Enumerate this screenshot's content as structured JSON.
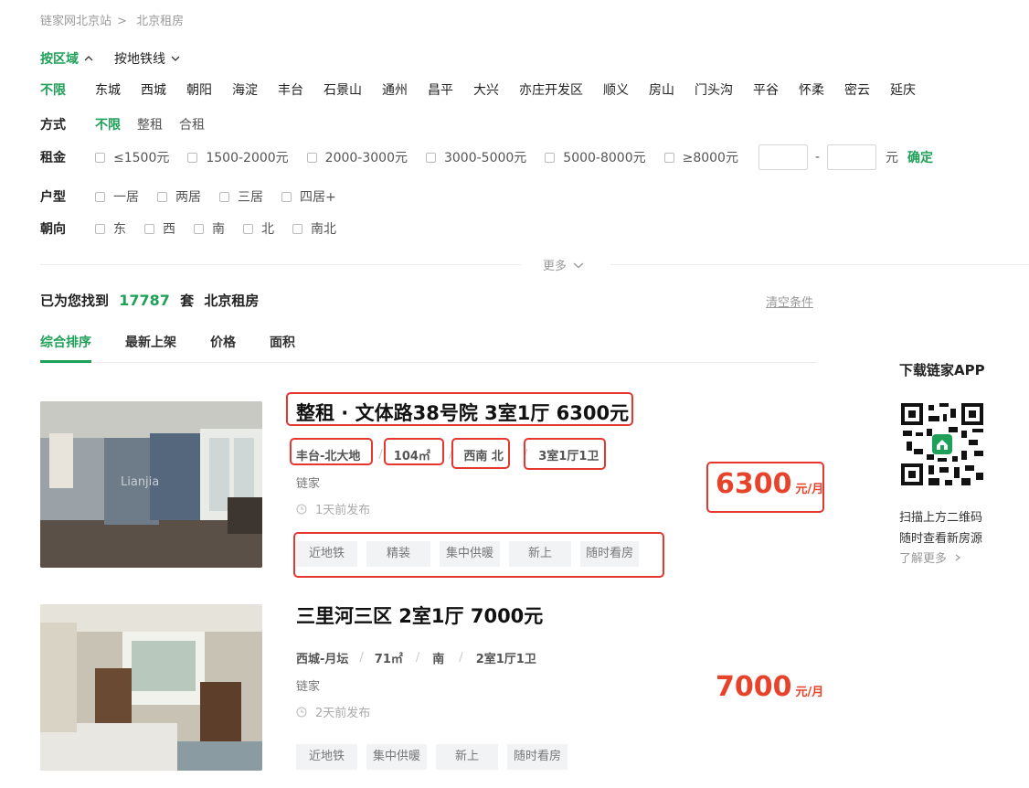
{
  "breadcrumb": {
    "site": "链家网北京站",
    "sep": ">",
    "current": "北京租房"
  },
  "filter_mode": {
    "by_area": "按区域",
    "by_subway": "按地铁线"
  },
  "areas": [
    "不限",
    "东城",
    "西城",
    "朝阳",
    "海淀",
    "丰台",
    "石景山",
    "通州",
    "昌平",
    "大兴",
    "亦庄开发区",
    "顺义",
    "房山",
    "门头沟",
    "平谷",
    "怀柔",
    "密云",
    "延庆"
  ],
  "rent_way": {
    "label": "方式",
    "options": [
      "不限",
      "整租",
      "合租"
    ]
  },
  "rent_price": {
    "label": "租金",
    "options": [
      "≤1500元",
      "1500-2000元",
      "2000-3000元",
      "3000-5000元",
      "5000-8000元",
      "≥8000元"
    ],
    "range_sep": "-",
    "unit": "元",
    "confirm": "确定"
  },
  "layout": {
    "label": "户型",
    "options": [
      "一居",
      "两居",
      "三居",
      "四居+"
    ]
  },
  "orientation": {
    "label": "朝向",
    "options": [
      "东",
      "西",
      "南",
      "北",
      "南北"
    ]
  },
  "more": "更多",
  "result": {
    "prefix": "已为您找到",
    "count": "17787",
    "mid": "套",
    "suffix": "北京租房",
    "clear": "清空条件"
  },
  "sort_tabs": [
    "综合排序",
    "最新上架",
    "价格",
    "面积"
  ],
  "listings": [
    {
      "title": "整租 · 文体路38号院 3室1厅 6300元",
      "district": "丰台-北大地",
      "size": "104㎡",
      "facing": "西南 北",
      "rooms": "3室1厅1卫",
      "agency": "链家",
      "posted": "1天前发布",
      "tags": [
        "近地铁",
        "精装",
        "集中供暖",
        "新上",
        "随时看房"
      ],
      "price": "6300",
      "unit": "元/月"
    },
    {
      "title": "三里河三区 2室1厅 7000元",
      "district": "西城-月坛",
      "size": "71㎡",
      "facing": "南",
      "rooms": "2室1厅1卫",
      "agency": "链家",
      "posted": "2天前发布",
      "tags": [
        "近地铁",
        "集中供暖",
        "新上",
        "随时看房"
      ],
      "price": "7000",
      "unit": "元/月"
    }
  ],
  "sidebar": {
    "app_title": "下载链家APP",
    "scan1": "扫描上方二维码",
    "scan2": "随时查看新房源",
    "learn_more": "了解更多"
  },
  "colors": {
    "accent": "#1fa058",
    "price_red": "#e7432b",
    "highlight_box": "#e5362f"
  }
}
